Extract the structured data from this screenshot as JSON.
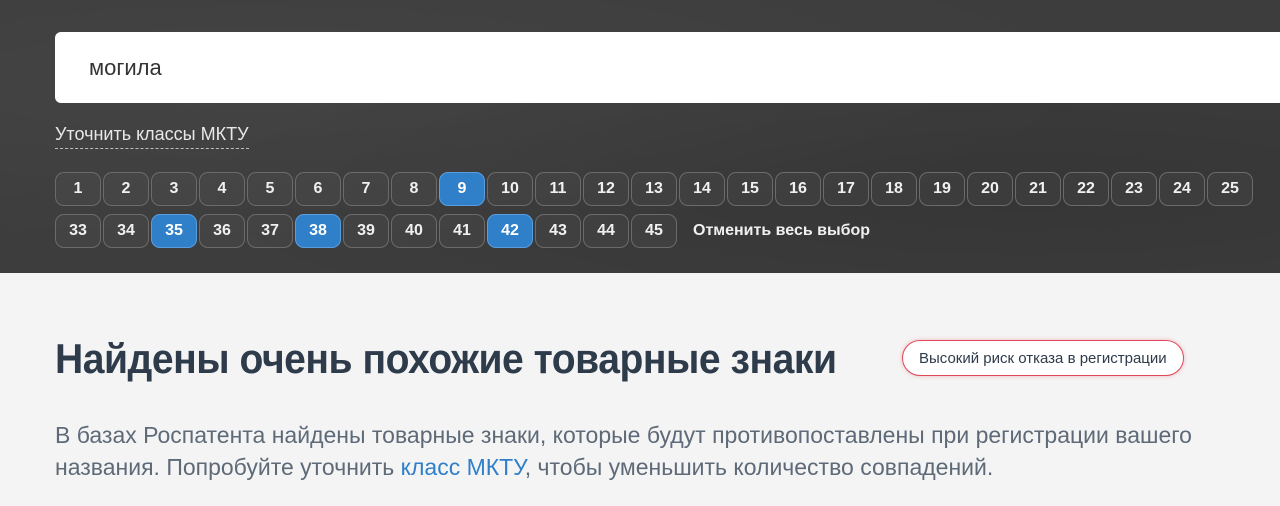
{
  "search": {
    "value": "могила"
  },
  "classes": {
    "refine_label": "Уточнить классы МКТУ",
    "row1": [
      {
        "label": "1",
        "selected": false
      },
      {
        "label": "2",
        "selected": false
      },
      {
        "label": "3",
        "selected": false
      },
      {
        "label": "4",
        "selected": false
      },
      {
        "label": "5",
        "selected": false
      },
      {
        "label": "6",
        "selected": false
      },
      {
        "label": "7",
        "selected": false
      },
      {
        "label": "8",
        "selected": false
      },
      {
        "label": "9",
        "selected": true
      },
      {
        "label": "10",
        "selected": false
      },
      {
        "label": "11",
        "selected": false
      },
      {
        "label": "12",
        "selected": false
      },
      {
        "label": "13",
        "selected": false
      },
      {
        "label": "14",
        "selected": false
      },
      {
        "label": "15",
        "selected": false
      },
      {
        "label": "16",
        "selected": false
      },
      {
        "label": "17",
        "selected": false
      },
      {
        "label": "18",
        "selected": false
      },
      {
        "label": "19",
        "selected": false
      },
      {
        "label": "20",
        "selected": false
      },
      {
        "label": "21",
        "selected": false
      },
      {
        "label": "22",
        "selected": false
      },
      {
        "label": "23",
        "selected": false
      },
      {
        "label": "24",
        "selected": false
      },
      {
        "label": "25",
        "selected": false
      }
    ],
    "row2": [
      {
        "label": "33",
        "selected": false
      },
      {
        "label": "34",
        "selected": false
      },
      {
        "label": "35",
        "selected": true
      },
      {
        "label": "36",
        "selected": false
      },
      {
        "label": "37",
        "selected": false
      },
      {
        "label": "38",
        "selected": true
      },
      {
        "label": "39",
        "selected": false
      },
      {
        "label": "40",
        "selected": false
      },
      {
        "label": "41",
        "selected": false
      },
      {
        "label": "42",
        "selected": true
      },
      {
        "label": "43",
        "selected": false
      },
      {
        "label": "44",
        "selected": false
      },
      {
        "label": "45",
        "selected": false
      }
    ],
    "reset_label": "Отменить весь выбор",
    "selected_color": "#2f7fc9"
  },
  "results": {
    "title": "Найдены очень похожие товарные знаки",
    "risk_badge": "Высокий риск отказа в регистрации",
    "risk_color": "#e0485a",
    "desc_before": "В базах Роспатента найдены товарные знаки, которые будут противопоставлены при регистрации вашего названия. Попробуйте уточнить ",
    "desc_link": "класс МКТУ",
    "desc_after": ", чтобы уменьшить количество совпадений."
  }
}
